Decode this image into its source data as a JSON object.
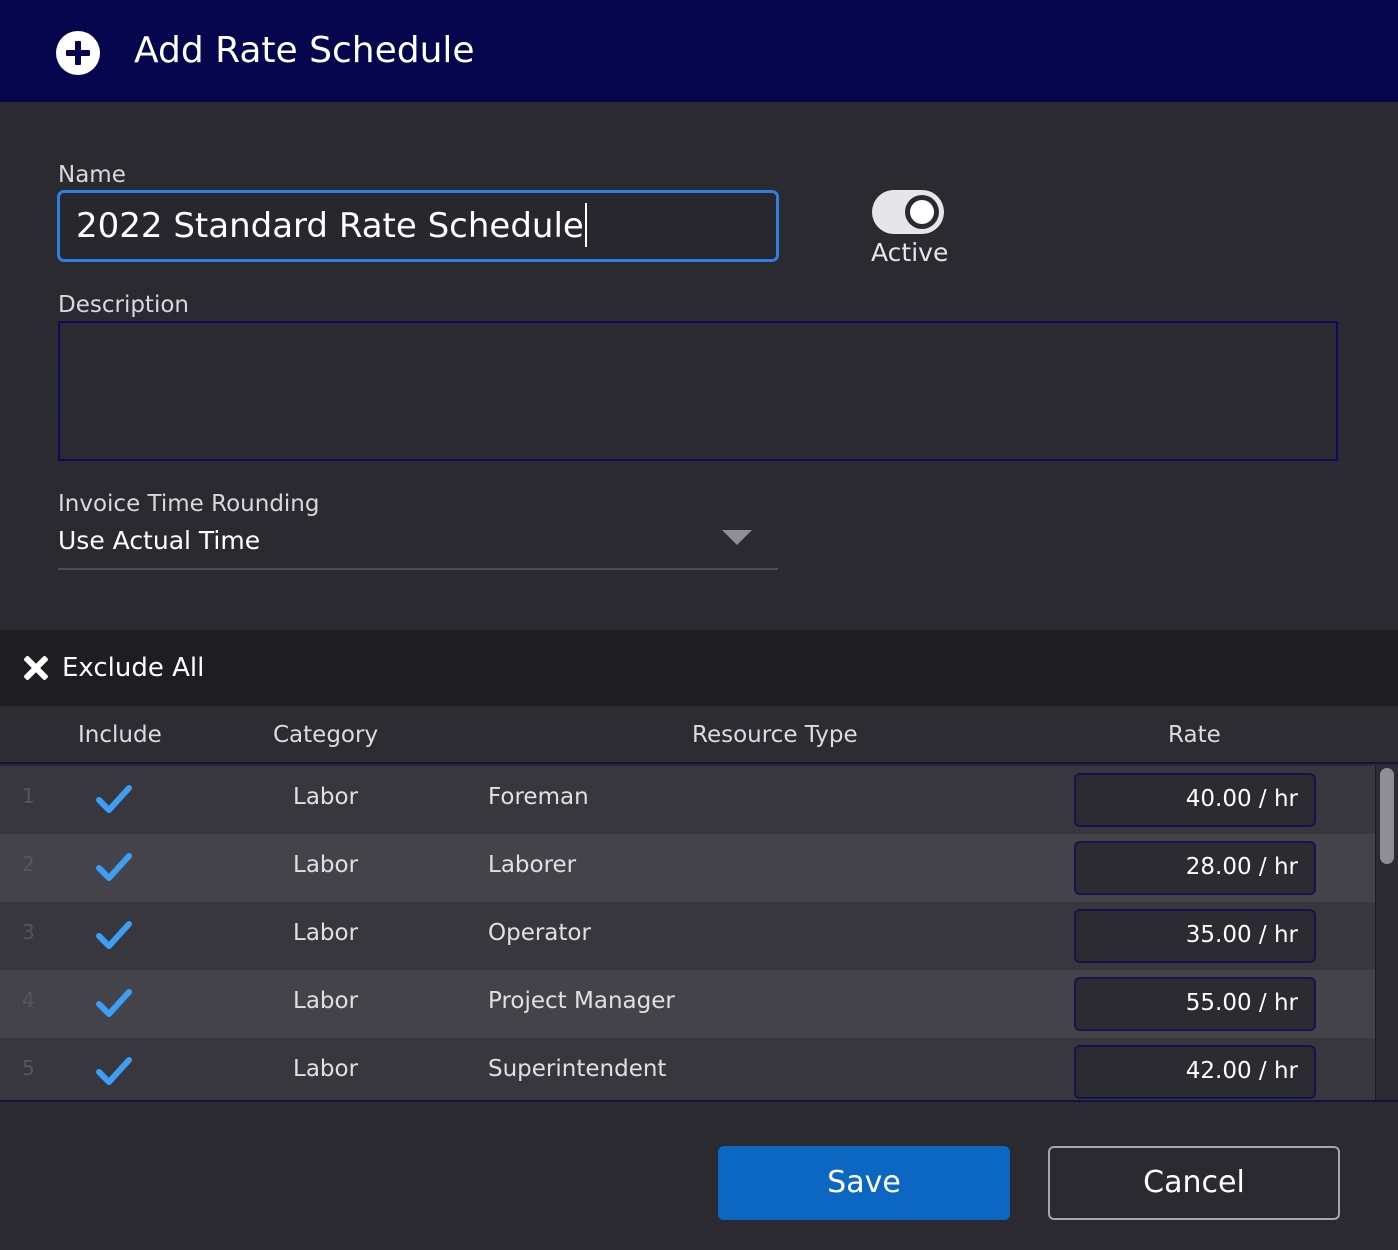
{
  "dialog": {
    "title": "Add Rate Schedule",
    "icon": "plus-circle-icon"
  },
  "form": {
    "name_label": "Name",
    "name_value": "2022 Standard Rate Schedule",
    "active_label": "Active",
    "active_on": true,
    "description_label": "Description",
    "description_value": "",
    "rounding_label": "Invoice Time Rounding",
    "rounding_value": "Use Actual Time"
  },
  "toolbar": {
    "exclude_all_label": "Exclude All",
    "icon": "close-x-icon"
  },
  "table": {
    "headers": {
      "include": "Include",
      "category": "Category",
      "resource_type": "Resource Type",
      "rate": "Rate"
    },
    "rows": [
      {
        "index": "1",
        "include": true,
        "category": "Labor",
        "resource_type": "Foreman",
        "rate": "40.00 / hr"
      },
      {
        "index": "2",
        "include": true,
        "category": "Labor",
        "resource_type": "Laborer",
        "rate": "28.00 / hr"
      },
      {
        "index": "3",
        "include": true,
        "category": "Labor",
        "resource_type": "Operator",
        "rate": "35.00 / hr"
      },
      {
        "index": "4",
        "include": true,
        "category": "Labor",
        "resource_type": "Project Manager",
        "rate": "55.00 / hr"
      },
      {
        "index": "5",
        "include": true,
        "category": "Labor",
        "resource_type": "Superintendent",
        "rate": "42.00 / hr"
      }
    ]
  },
  "actions": {
    "save_label": "Save",
    "cancel_label": "Cancel"
  },
  "colors": {
    "header_bg": "#05064d",
    "accent": "#2d7fe6",
    "check": "#3d9ef5",
    "save_bg": "#0b67c2"
  }
}
